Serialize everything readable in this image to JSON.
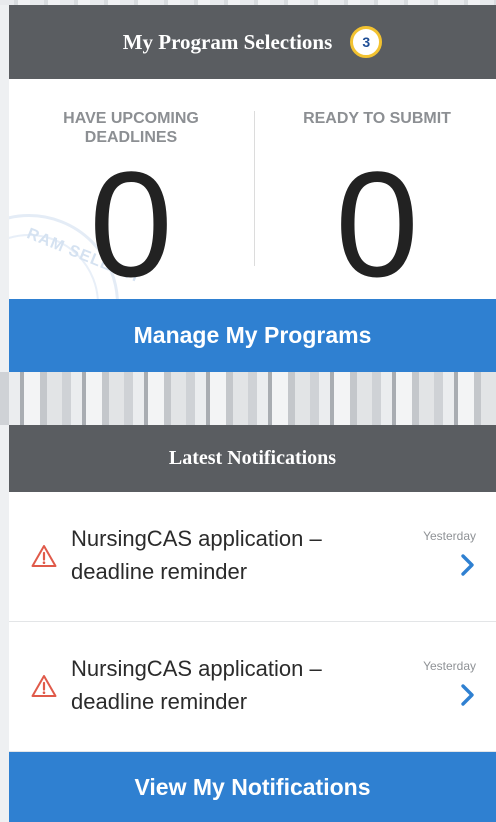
{
  "program_selections": {
    "title": "My Program Selections",
    "badge_count": "3",
    "upcoming_label": "HAVE UPCOMING DEADLINES",
    "upcoming_count": "0",
    "ready_label": "READY TO SUBMIT",
    "ready_count": "0",
    "seal_text": "RAM SELECTI",
    "manage_button": "Manage My Programs"
  },
  "notifications": {
    "title": "Latest Notifications",
    "items": [
      {
        "text": "NursingCAS application – deadline reminder",
        "time": "Yesterday",
        "icon": "warning-icon"
      },
      {
        "text": "NursingCAS application – deadline reminder",
        "time": "Yesterday",
        "icon": "warning-icon"
      }
    ],
    "view_button": "View My Notifications"
  },
  "colors": {
    "header_bg": "#5a5d61",
    "button_bg": "#2f80d1",
    "badge_border": "#f2c230",
    "warning": "#e05a4a",
    "chevron": "#2f80d1"
  }
}
